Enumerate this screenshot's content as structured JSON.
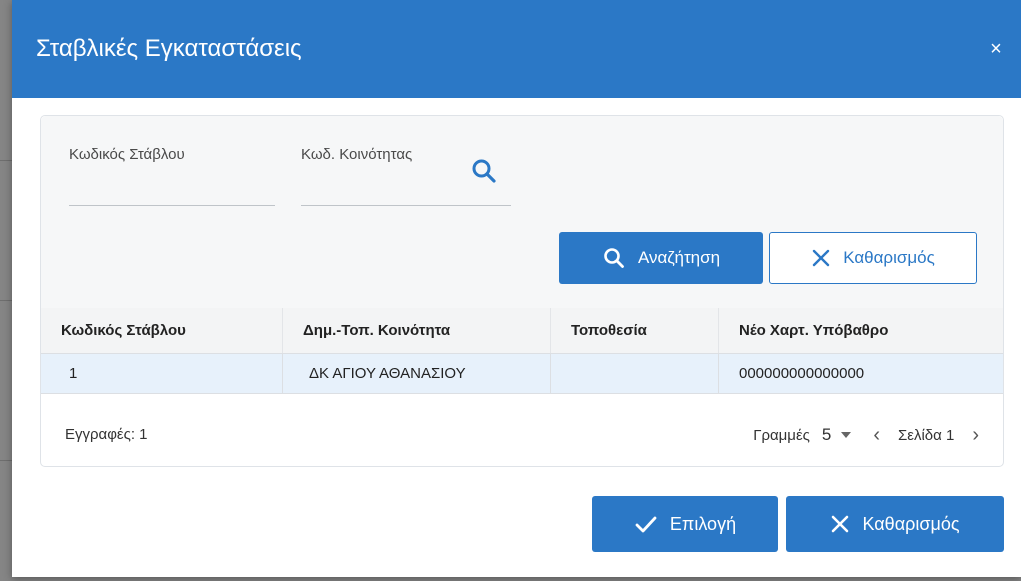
{
  "dialog": {
    "title": "Σταβλικές Εγκαταστάσεις",
    "close_label": "×"
  },
  "filters": {
    "stable_code_label": "Κωδικός Στάβλου",
    "community_code_label": "Κωδ. Κοινότητας"
  },
  "buttons": {
    "search_label": "Αναζήτηση",
    "clear_label": "Καθαρισμός",
    "select_label": "Επιλογή",
    "clear_bottom_label": "Καθαρισμός"
  },
  "table": {
    "columns": [
      "Κωδικός Στάβλου",
      "Δημ.-Τοπ. Κοινότητα",
      "Τοποθεσία",
      "Νέο Χαρτ. Υπόβαθρο"
    ],
    "rows": [
      [
        "1",
        "ΔΚ ΑΓΙΟΥ ΑΘΑΝΑΣΙΟΥ",
        "",
        "000000000000000"
      ]
    ]
  },
  "footer": {
    "records_text": "Εγγραφές: 1",
    "rows_label": "Γραμμές",
    "rows_value": "5",
    "page_text": "Σελίδα 1"
  },
  "colors": {
    "primary": "#2b78c6",
    "selected_row": "#e7f1fb"
  }
}
